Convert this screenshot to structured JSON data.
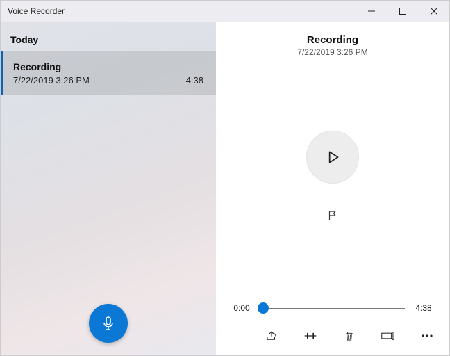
{
  "window": {
    "title": "Voice Recorder"
  },
  "colors": {
    "accent": "#0a78d4"
  },
  "sidebar": {
    "section": "Today",
    "items": [
      {
        "title": "Recording",
        "datetime": "7/22/2019 3:26 PM",
        "duration": "4:38",
        "selected": true
      }
    ]
  },
  "detail": {
    "title": "Recording",
    "subtitle": "7/22/2019 3:26 PM",
    "playback": {
      "position": "0:00",
      "duration": "4:38",
      "progress_pct": 0
    },
    "icons": {
      "play": "play-icon",
      "flag": "flag-icon",
      "share": "share-icon",
      "trim": "trim-icon",
      "delete": "trash-icon",
      "rename": "rename-icon",
      "more": "more-icon"
    }
  },
  "record": {
    "icon": "microphone-icon"
  }
}
